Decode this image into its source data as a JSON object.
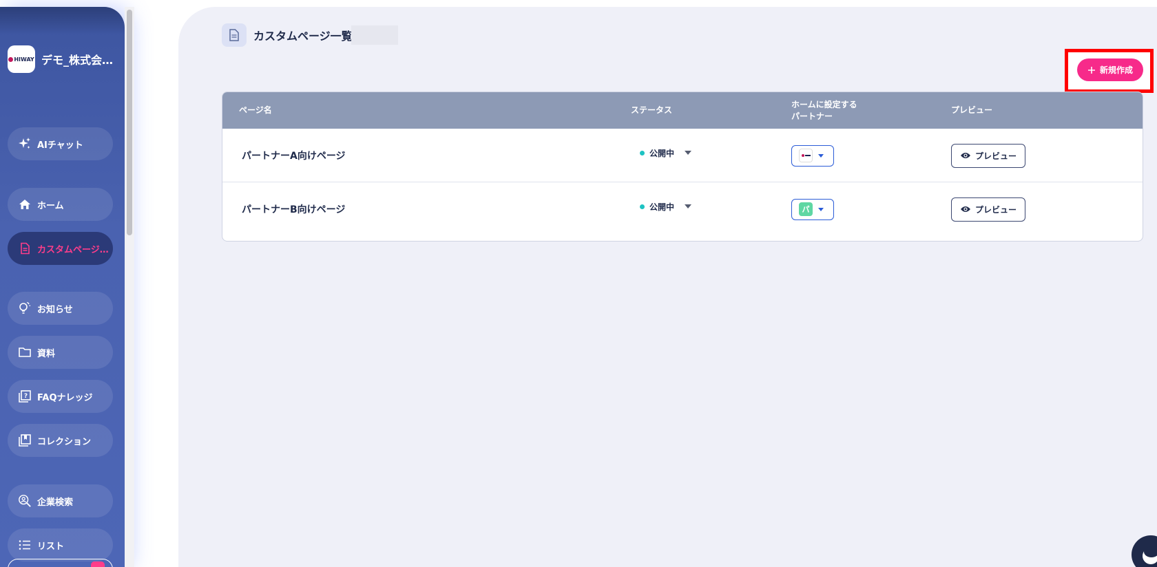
{
  "sidebar": {
    "brand": {
      "logo_text": "HIWAY",
      "name": "デモ_株式会社…"
    },
    "items": [
      {
        "label": "AIチャット",
        "icon": "sparkle-icon"
      },
      {
        "label": "ホーム",
        "icon": "home-icon"
      },
      {
        "label": "カスタムページ…",
        "icon": "document-icon",
        "active": true
      },
      {
        "label": "お知らせ",
        "icon": "lightbulb-icon"
      },
      {
        "label": "資料",
        "icon": "folder-icon"
      },
      {
        "label": "FAQナレッジ",
        "icon": "faq-icon"
      },
      {
        "label": "コレクション",
        "icon": "collection-icon"
      },
      {
        "label": "企業検索",
        "icon": "company-search-icon"
      },
      {
        "label": "リスト",
        "icon": "list-icon"
      }
    ]
  },
  "header": {
    "title": "カスタムページ一覧",
    "new_button_label": "新規作成"
  },
  "table": {
    "columns": [
      "ページ名",
      "ステータス",
      "ホームに設定する",
      "パートナー",
      "プレビュー"
    ],
    "rows": [
      {
        "page_name": "パートナーA向けページ",
        "status": "公開中",
        "partner_thumb": "hiway",
        "preview_label": "プレビュー"
      },
      {
        "page_name": "パートナーB向けページ",
        "status": "公開中",
        "partner_thumb": "パ",
        "preview_label": "プレビュー"
      }
    ]
  },
  "colors": {
    "sidebar": "#4a62b0",
    "accent_pink": "#f72a8a",
    "table_header": "#8d9ab5",
    "status_dot": "#1ec3c3",
    "highlight": "#ff0000"
  }
}
